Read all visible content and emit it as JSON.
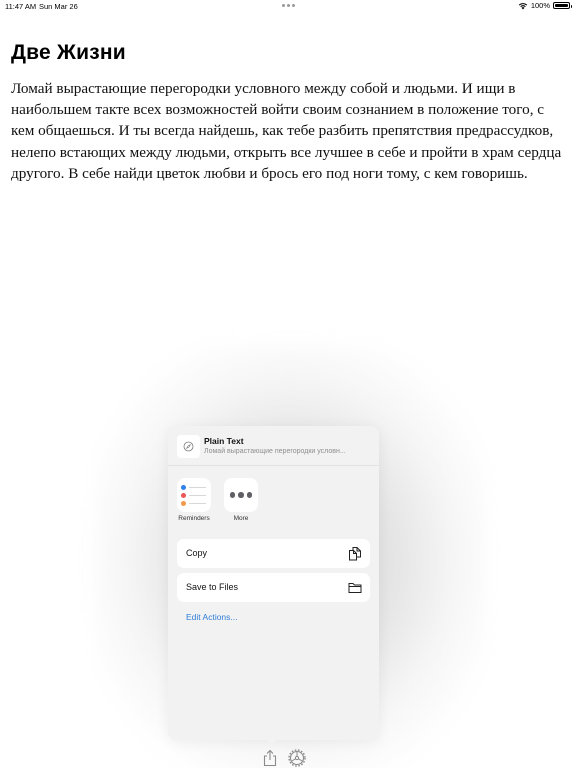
{
  "status_bar": {
    "time": "11:47 AM",
    "date": "Sun Mar 26",
    "battery": "100%",
    "battery_level_percent": 100
  },
  "document": {
    "title": "Две Жизни",
    "body": "Ломай вырастающие перегородки условного между собой и людьми. И ищи в наибольшем такте всех возможностей войти своим сознанием в положение того, с кем общаешься. И ты всегда найдешь, как тебе разбить препятствия предрассудков, нелепо встающих между людьми, открыть все лучшее в себе и пройти в храм сердца другого. В себе найди цветок любви и брось его под ноги тому, с кем говоришь."
  },
  "share_sheet": {
    "header": {
      "icon": "compass-icon",
      "title": "Plain Text",
      "subtitle": "Ломай вырастающие перегородки условн..."
    },
    "apps": [
      {
        "label": "Reminders",
        "icon": "reminders-icon",
        "dot_colors": [
          "#2f80ed",
          "#eb5757",
          "#f2994a"
        ]
      },
      {
        "label": "More",
        "icon": "more-icon"
      }
    ],
    "actions": [
      {
        "label": "Copy",
        "icon": "copy-icon"
      },
      {
        "label": "Save to Files",
        "icon": "folder-icon"
      }
    ],
    "edit_actions_label": "Edit Actions...",
    "link_color": "#2f7ed8"
  },
  "toolbar": {
    "share_icon": "share-icon",
    "settings_icon": "settings-icon"
  }
}
